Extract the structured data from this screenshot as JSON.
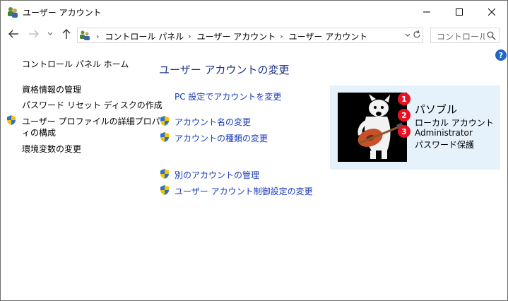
{
  "window": {
    "title": "ユーザー アカウント"
  },
  "nav": {
    "breadcrumbs": [
      "コントロール パネル",
      "ユーザー アカウント",
      "ユーザー アカウント"
    ],
    "search_placeholder": "コントロール パネルの検索"
  },
  "sidebar": {
    "home_link": "コントロール パネル ホーム",
    "links": [
      "資格情報の管理",
      "パスワード リセット ディスクの作成"
    ],
    "profile_link_line1": "ユーザー プロファイルの詳細プロパテ",
    "profile_link_line2": "ィの構成",
    "env_link": "環境変数の変更"
  },
  "main": {
    "title": "ユーザー アカウントの変更",
    "pc_settings_link": "PC 設定でアカウントを変更",
    "links": [
      "アカウント名の変更",
      "アカウントの種類の変更",
      "別のアカウントの管理",
      "ユーザー アカウント制御設定の変更"
    ]
  },
  "account": {
    "name": "パソブル",
    "type": "ローカル アカウント",
    "role": "Administrator",
    "protection": "パスワード保護",
    "badges": [
      "1",
      "2",
      "3"
    ]
  },
  "icons": {
    "help": "?"
  },
  "colors": {
    "link": "#1a3bb8",
    "title": "#1e3287",
    "card_bg": "#e5f1fb",
    "badge": "#e81123"
  }
}
